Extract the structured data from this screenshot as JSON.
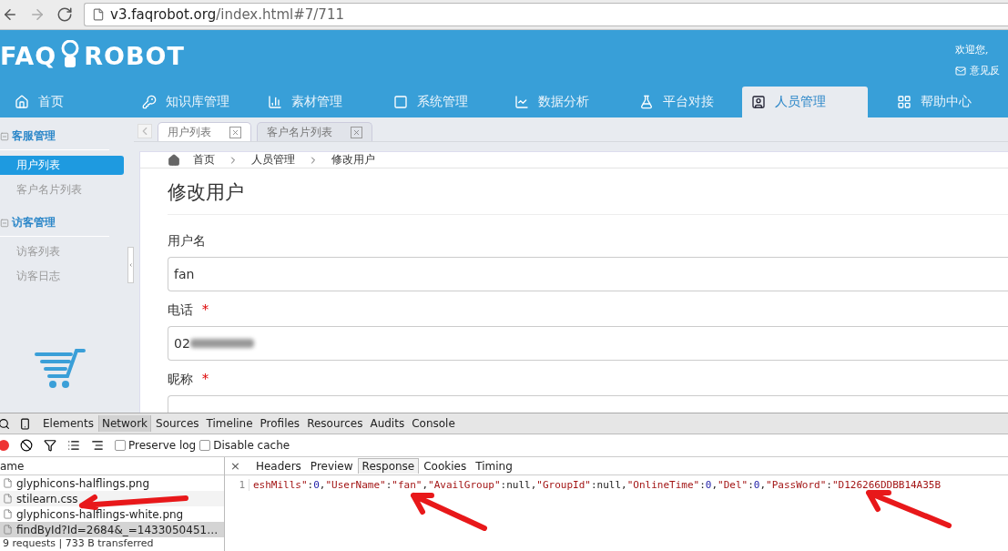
{
  "browser": {
    "host": "v3.faqrobot.org",
    "path": "/index.html#7/711"
  },
  "header": {
    "logo_left": "FAQ",
    "logo_right": "ROBOT",
    "welcome": "欢迎您,",
    "feedback": "意见反"
  },
  "nav": [
    {
      "label": "首页",
      "selected": false
    },
    {
      "label": "知识库管理",
      "selected": false
    },
    {
      "label": "素材管理",
      "selected": false
    },
    {
      "label": "系统管理",
      "selected": false
    },
    {
      "label": "数据分析",
      "selected": false
    },
    {
      "label": "平台对接",
      "selected": false
    },
    {
      "label": "人员管理",
      "selected": true
    },
    {
      "label": "帮助中心",
      "selected": false
    }
  ],
  "sidebar": {
    "groups": [
      {
        "label": "客服管理",
        "expanded": true,
        "children": [
          {
            "label": "用户列表",
            "selected": true
          },
          {
            "label": "客户名片列表",
            "selected": false
          }
        ]
      },
      {
        "label": "访客管理",
        "expanded": true,
        "children": [
          {
            "label": "访客列表",
            "selected": false
          },
          {
            "label": "访客日志",
            "selected": false
          }
        ]
      }
    ]
  },
  "tabs": [
    {
      "label": "用户列表",
      "selected": true
    },
    {
      "label": "客户名片列表",
      "selected": false
    }
  ],
  "breadcrumb": [
    "首页",
    "人员管理",
    "修改用户"
  ],
  "title": "修改用户",
  "fields": [
    {
      "label": "用户名",
      "value": "fan"
    },
    {
      "label": "电话",
      "mark": "*",
      "value": "02",
      "redacted": true
    },
    {
      "label": "昵称",
      "mark": "*"
    }
  ],
  "devtools": {
    "tabs": [
      {
        "label": "Elements",
        "selected": false
      },
      {
        "label": "Network",
        "selected": true
      },
      {
        "label": "Sources",
        "selected": false
      },
      {
        "label": "Timeline",
        "selected": false
      },
      {
        "label": "Profiles",
        "selected": false
      },
      {
        "label": "Resources",
        "selected": false
      },
      {
        "label": "Audits",
        "selected": false
      },
      {
        "label": "Console",
        "selected": false
      }
    ],
    "options": [
      {
        "label": "Preserve log",
        "checked": false
      },
      {
        "label": "Disable cache",
        "checked": false
      }
    ],
    "name_header": "ame",
    "requests": [
      {
        "name": "glyphicons-halflings.png",
        "selected": false
      },
      {
        "name": "stilearn.css",
        "selected": false
      },
      {
        "name": "glyphicons-halflings-white.png",
        "selected": false
      },
      {
        "name": "findById?Id=2684&_=1433050451…",
        "selected": true
      }
    ],
    "status": "9 requests | 733 B transferred",
    "close": "×",
    "detail_tabs": [
      {
        "label": "Headers",
        "selected": false
      },
      {
        "label": "Preview",
        "selected": false
      },
      {
        "label": "Response",
        "selected": true
      },
      {
        "label": "Cookies",
        "selected": false
      },
      {
        "label": "Timing",
        "selected": false
      }
    ],
    "line_number": "1",
    "response": [
      {
        "kind": "string",
        "text": "eshMills\""
      },
      {
        "kind": "plain",
        "text": ":"
      },
      {
        "kind": "number",
        "text": "0"
      },
      {
        "kind": "plain",
        "text": ","
      },
      {
        "kind": "string",
        "text": "\"UserName\""
      },
      {
        "kind": "plain",
        "text": ":"
      },
      {
        "kind": "string",
        "text": "\"fan\""
      },
      {
        "kind": "plain",
        "text": ","
      },
      {
        "kind": "string",
        "text": "\"AvailGroup\""
      },
      {
        "kind": "plain",
        "text": ":null,"
      },
      {
        "kind": "string",
        "text": "\"GroupId\""
      },
      {
        "kind": "plain",
        "text": ":null,"
      },
      {
        "kind": "string",
        "text": "\"OnlineTime\""
      },
      {
        "kind": "plain",
        "text": ":"
      },
      {
        "kind": "number",
        "text": "0"
      },
      {
        "kind": "plain",
        "text": ","
      },
      {
        "kind": "string",
        "text": "\"Del\""
      },
      {
        "kind": "plain",
        "text": ":"
      },
      {
        "kind": "number",
        "text": "0"
      },
      {
        "kind": "plain",
        "text": ","
      },
      {
        "kind": "string",
        "text": "\"PassWord\""
      },
      {
        "kind": "plain",
        "text": ":"
      },
      {
        "kind": "string",
        "text": "\"D126266DDBB14A35B"
      }
    ]
  }
}
